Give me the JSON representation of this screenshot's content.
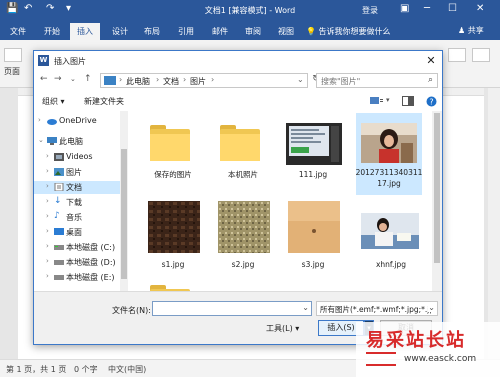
{
  "word": {
    "title": "文档1 [兼容模式] - Word",
    "signin": "登录",
    "tabs": [
      "文件",
      "开始",
      "插入",
      "设计",
      "布局",
      "引用",
      "邮件",
      "审阅",
      "视图"
    ],
    "active_tab": "插入",
    "tell_me": "告诉我你想要做什么",
    "share": "共享",
    "ribbon_label": "页面",
    "status": {
      "page": "第 1 页，共 1 页",
      "words": "0 个字",
      "lang": "中文(中国)"
    }
  },
  "dialog": {
    "title": "插入图片",
    "breadcrumbs": [
      "此电脑",
      "文档",
      "图片"
    ],
    "search_placeholder": "搜索\"图片\"",
    "toolbar": {
      "organize": "组织 ▾",
      "new_folder": "新建文件夹"
    },
    "nav": [
      {
        "label": "OneDrive",
        "icon": "cloud-icon",
        "indent": 1,
        "arrow": "›"
      },
      {
        "label": "此电脑",
        "icon": "computer-icon",
        "indent": 1,
        "arrow": "⌄"
      },
      {
        "label": "Videos",
        "icon": "videos-icon",
        "indent": 2,
        "arrow": "›"
      },
      {
        "label": "图片",
        "icon": "pictures-icon",
        "indent": 2,
        "arrow": "›"
      },
      {
        "label": "文档",
        "icon": "documents-icon",
        "indent": 2,
        "arrow": "›",
        "selected": true
      },
      {
        "label": "下载",
        "icon": "download-icon",
        "indent": 2,
        "arrow": "›"
      },
      {
        "label": "音乐",
        "icon": "music-icon",
        "indent": 2,
        "arrow": "›"
      },
      {
        "label": "桌面",
        "icon": "desktop-icon",
        "indent": 2,
        "arrow": "›"
      },
      {
        "label": "本地磁盘 (C:)",
        "icon": "drive-icon",
        "indent": 2,
        "arrow": "›"
      },
      {
        "label": "本地磁盘 (D:)",
        "icon": "drive-icon",
        "indent": 2,
        "arrow": "›"
      },
      {
        "label": "本地磁盘 (E:)",
        "icon": "drive-icon",
        "indent": 2,
        "arrow": "›"
      }
    ],
    "files": [
      {
        "name": "保存的图片",
        "kind": "folder"
      },
      {
        "name": "本机照片",
        "kind": "folder"
      },
      {
        "name": "111.jpg",
        "kind": "screen"
      },
      {
        "name": "20127311340311 17.jpg",
        "kind": "photo-girl",
        "selected": true
      },
      {
        "name": "s1.jpg",
        "kind": "texture-dark"
      },
      {
        "name": "s2.jpg",
        "kind": "texture-gravel"
      },
      {
        "name": "s3.jpg",
        "kind": "texture-sand"
      },
      {
        "name": "xhnf.jpg",
        "kind": "photo-reader"
      },
      {
        "name": "",
        "kind": "folder-partial"
      }
    ],
    "filename_label": "文件名(N):",
    "filename_value": "",
    "filter": "所有图片(*.emf;*.wmf;*.jpg;*.jp",
    "tools": "工具(L)",
    "insert": "插入(S)",
    "cancel": "取消"
  },
  "watermark": {
    "text": "易采站长站",
    "url": "www.easck.com"
  }
}
